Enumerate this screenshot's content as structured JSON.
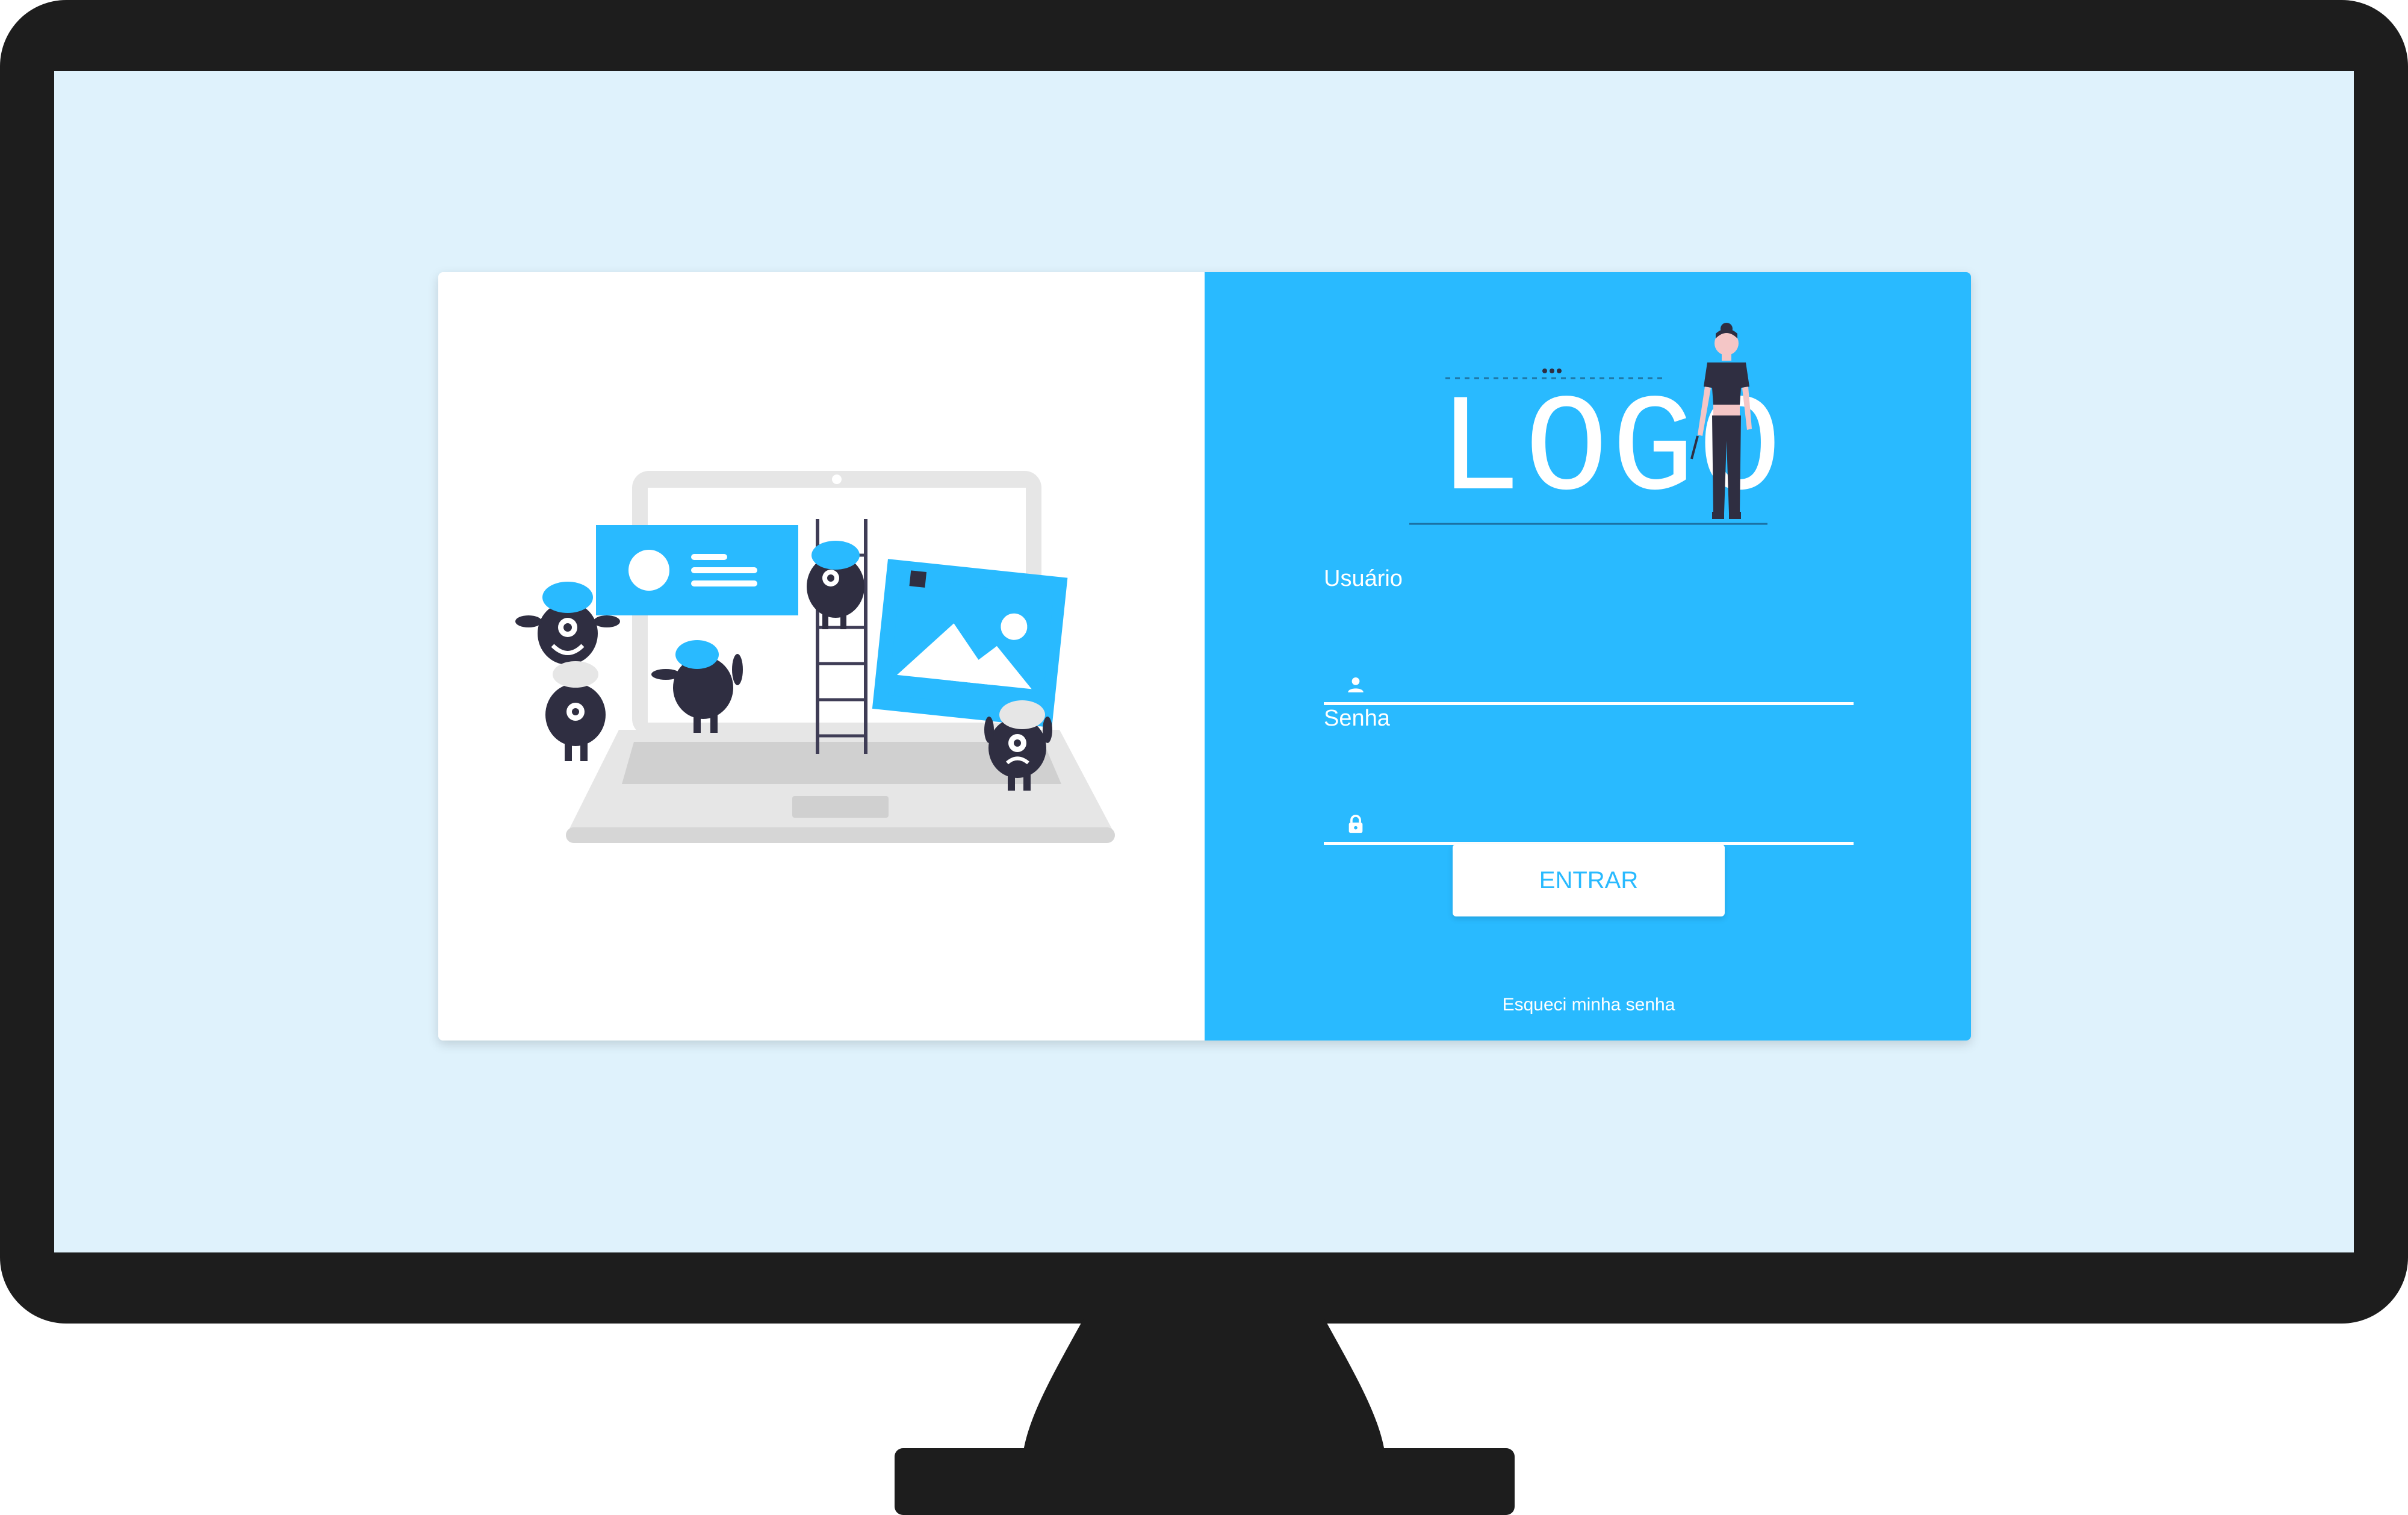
{
  "login": {
    "logo_text": "LOGO",
    "username_label": "Usuário",
    "username_value": "",
    "password_label": "Senha",
    "password_value": "",
    "submit_label": "ENTRAR",
    "forgot_label": "Esqueci minha senha"
  },
  "icons": {
    "username": "user-icon",
    "password": "lock-icon"
  },
  "colors": {
    "accent": "#29baff",
    "screen_background": "#dff2fc",
    "monitor_frame": "#1d1d1d",
    "character_dark": "#2f2e41"
  }
}
